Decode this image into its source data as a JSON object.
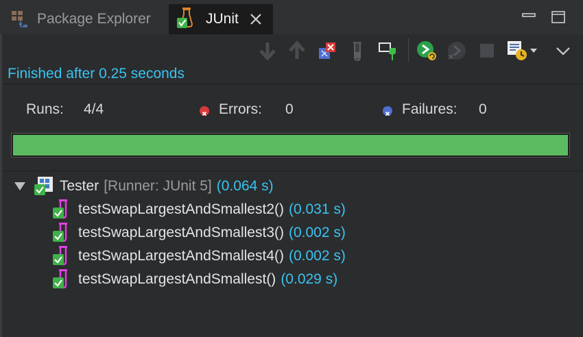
{
  "tabs": {
    "package_explorer": "Package Explorer",
    "junit": "JUnit"
  },
  "status": "Finished after 0.25 seconds",
  "counters": {
    "runs_label": "Runs:",
    "runs_value": "4/4",
    "errors_label": "Errors:",
    "errors_value": "0",
    "failures_label": "Failures:",
    "failures_value": "0"
  },
  "progress": {
    "fraction": 1.0,
    "color": "#5cbb61"
  },
  "tree": {
    "root": {
      "name": "Tester",
      "runner": "[Runner: JUnit 5]",
      "time": "(0.064 s)"
    },
    "tests": [
      {
        "name": "testSwapLargestAndSmallest2()",
        "time": "(0.031 s)"
      },
      {
        "name": "testSwapLargestAndSmallest3()",
        "time": "(0.002 s)"
      },
      {
        "name": "testSwapLargestAndSmallest4()",
        "time": "(0.002 s)"
      },
      {
        "name": "testSwapLargestAndSmallest()",
        "time": "(0.029 s)"
      }
    ]
  },
  "colors": {
    "accent_blue": "#39c4f0",
    "pass_green": "#5cbb61",
    "test_magenta": "#e040e0",
    "error_red": "#d83a3a"
  },
  "icons": {
    "package_explorer": "package-explorer-icon",
    "junit": "junit-flask-icon",
    "close": "close-icon",
    "minimize": "minimize-icon",
    "maximize": "maximize-icon",
    "next_failure": "next-failure-icon",
    "previous_failure": "previous-failure-icon",
    "show_failures_only": "show-failures-only-icon",
    "show_skipped": "show-skipped-tests-icon",
    "scroll_lock": "scroll-lock-icon",
    "rerun": "rerun-test-icon",
    "rerun_failed": "rerun-failed-first-icon",
    "stop": "stop-icon",
    "history": "test-run-history-icon",
    "view_menu": "view-menu-icon"
  }
}
